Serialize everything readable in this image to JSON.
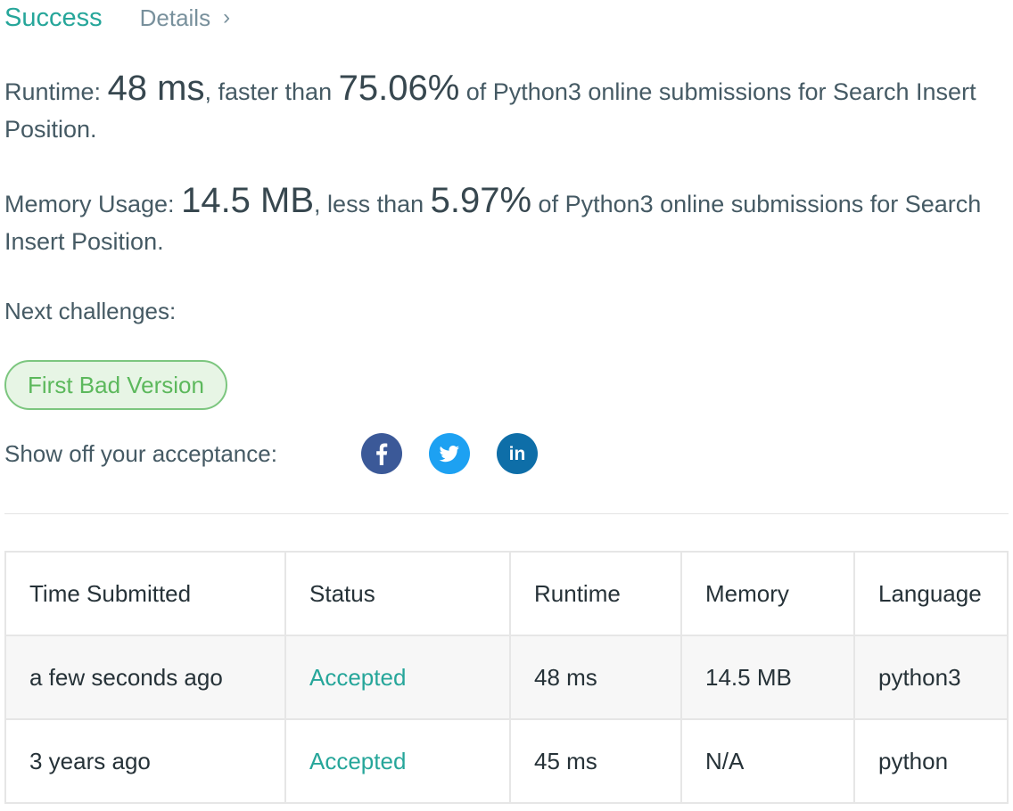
{
  "header": {
    "status": "Success",
    "details_label": "Details",
    "chevron": "›"
  },
  "runtime": {
    "label": "Runtime:",
    "value": "48 ms",
    "mid": ", faster than ",
    "percent": "75.06%",
    "tail": " of Python3 online submissions for Search Insert Position."
  },
  "memory": {
    "label": "Memory Usage:",
    "value": "14.5 MB",
    "mid": ", less than ",
    "percent": "5.97%",
    "tail": " of Python3 online submissions for Search Insert Position."
  },
  "next": {
    "label": "Next challenges:",
    "challenge": "First Bad Version"
  },
  "share": {
    "label": "Show off your acceptance:",
    "icons": [
      "facebook-icon",
      "twitter-icon",
      "linkedin-icon"
    ],
    "colors": {
      "facebook": "#3b5998",
      "twitter": "#1da1f2",
      "linkedin": "#0e6ea8"
    }
  },
  "table": {
    "headers": [
      "Time Submitted",
      "Status",
      "Runtime",
      "Memory",
      "Language"
    ],
    "rows": [
      [
        "a few seconds ago",
        "Accepted",
        "48 ms",
        "14.5 MB",
        "python3"
      ],
      [
        "3 years ago",
        "Accepted",
        "45 ms",
        "N/A",
        "python"
      ]
    ]
  },
  "colors": {
    "accent": "#26a69a",
    "challenge_green": "#5cb85c"
  }
}
